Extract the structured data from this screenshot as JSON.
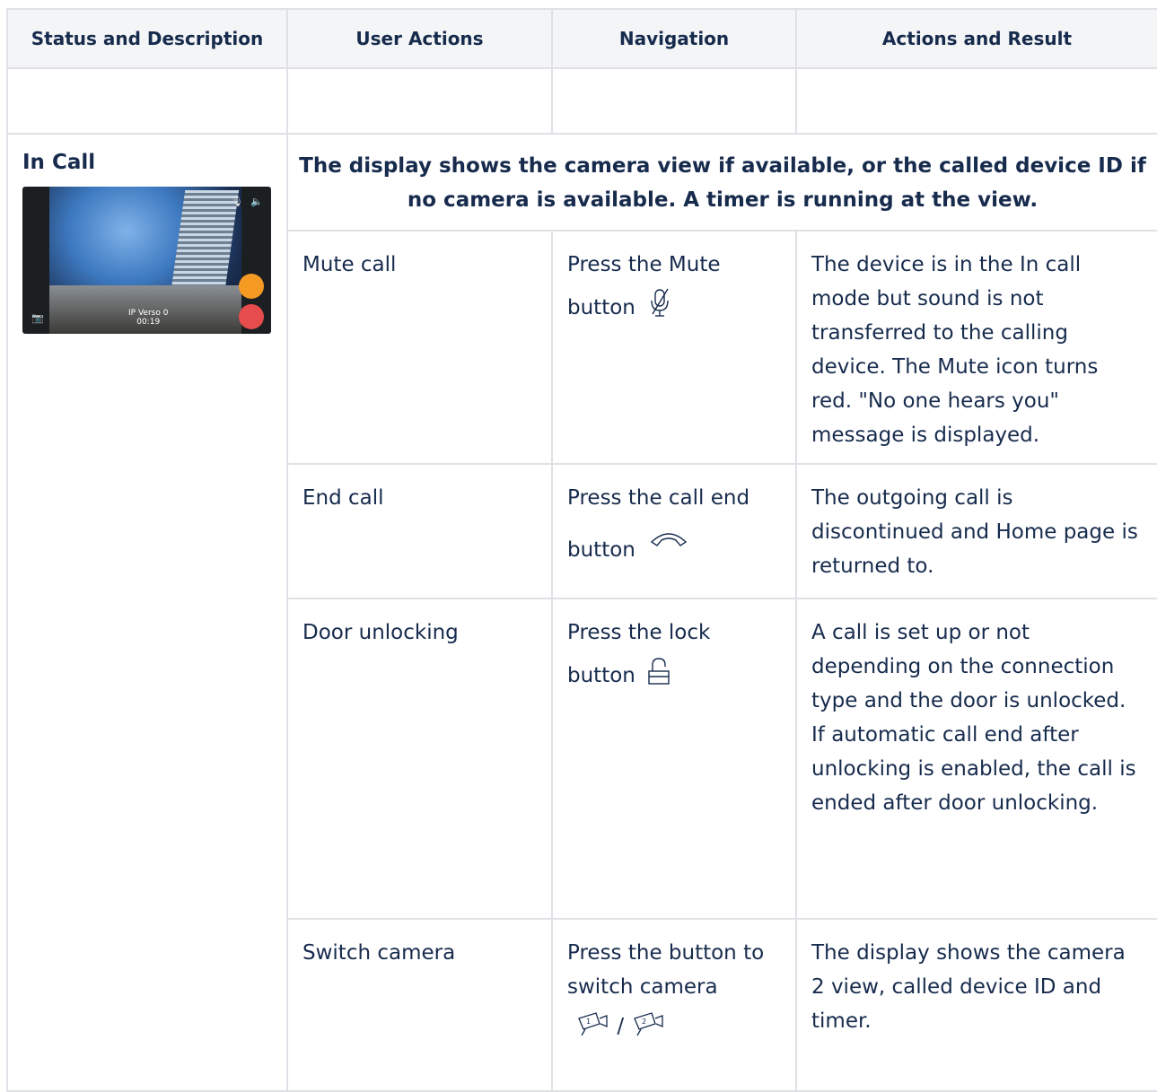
{
  "headers": [
    "Status and Description",
    "User Actions",
    "Navigation",
    "Actions and Result"
  ],
  "status": {
    "title": "In Call",
    "thumbnail": {
      "device_label": "IP Verso 0",
      "timer": "00:19"
    }
  },
  "span_heading": "The display shows the camera view if available, or the called device ID if no camera is available. A timer is running at the view.",
  "rows": [
    {
      "action": "Mute call",
      "nav_line1": "Press the Mute",
      "nav_line2": "button",
      "icon": "mute-microphone-icon",
      "result": "The device is in the In call mode but sound is not transferred to the calling device. The Mute icon turns red. \"No one hears you\" message is displayed."
    },
    {
      "action": "End call",
      "nav_line1": "Press the call end",
      "nav_line2": "button",
      "icon": "call-end-icon",
      "result": "The outgoing call is discontinued and Home page is returned to."
    },
    {
      "action": "Door unlocking",
      "nav_line1": "Press the lock",
      "nav_line2": "button",
      "icon": "lock-icon",
      "result": "A call is set up or not depending on the connection type and the door is unlocked. If automatic call end after unlocking is enabled, the call is ended after door unlocking."
    },
    {
      "action": "Switch camera",
      "nav_line1": "Press the button to switch camera",
      "nav_line2": "/",
      "icon": "camera-switch-icon",
      "result": "The display shows the camera 2 view, called device ID and timer."
    }
  ]
}
